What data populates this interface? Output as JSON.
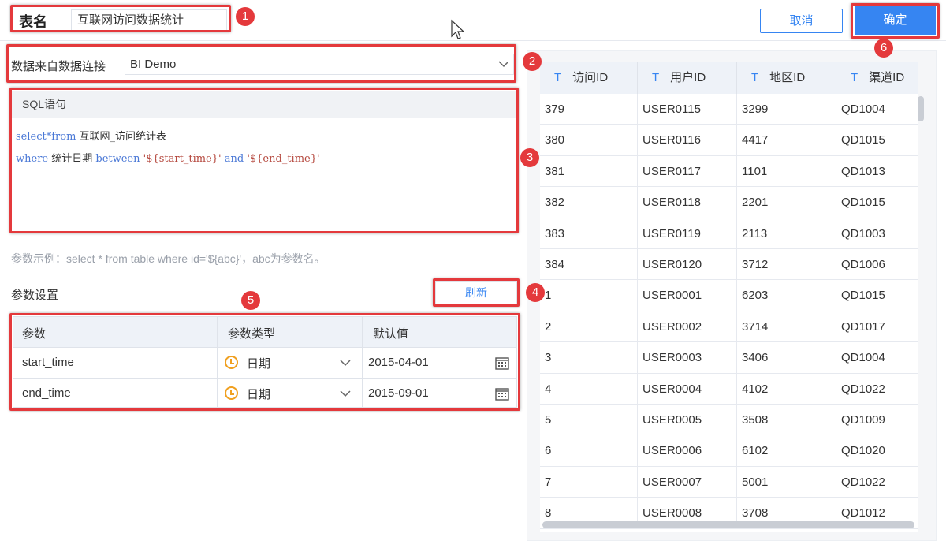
{
  "header": {
    "table_name_label": "表名",
    "table_name_value": "互联网访问数据统计",
    "cancel_label": "取消",
    "confirm_label": "确定"
  },
  "datasource": {
    "label": "数据来自数据连接",
    "selected": "BI Demo"
  },
  "sql": {
    "title": "SQL语句",
    "line1": {
      "kw": "select*from",
      "rest": " 互联网_访问统计表"
    },
    "line2": {
      "kw_where": "where",
      "mid": " 统计日期 ",
      "kw_between": "between",
      "str1": " '${start_time}' ",
      "kw_and": "and",
      "str2": " '${end_time}'"
    }
  },
  "hint": "参数示例：select * from table where id='${abc}'，abc为参数名。",
  "params": {
    "title": "参数设置",
    "refresh_label": "刷新",
    "columns": [
      "参数",
      "参数类型",
      "默认值"
    ],
    "rows": [
      {
        "name": "start_time",
        "type": "日期",
        "default": "2015-04-01"
      },
      {
        "name": "end_time",
        "type": "日期",
        "default": "2015-09-01"
      }
    ]
  },
  "result": {
    "type_icon": "T",
    "columns": [
      "访问ID",
      "用户ID",
      "地区ID",
      "渠道ID"
    ],
    "rows": [
      [
        "379",
        "USER0115",
        "3299",
        "QD1004"
      ],
      [
        "380",
        "USER0116",
        "4417",
        "QD1015"
      ],
      [
        "381",
        "USER0117",
        "1101",
        "QD1013"
      ],
      [
        "382",
        "USER0118",
        "2201",
        "QD1015"
      ],
      [
        "383",
        "USER0119",
        "2113",
        "QD1003"
      ],
      [
        "384",
        "USER0120",
        "3712",
        "QD1006"
      ],
      [
        "1",
        "USER0001",
        "6203",
        "QD1015"
      ],
      [
        "2",
        "USER0002",
        "3714",
        "QD1017"
      ],
      [
        "3",
        "USER0003",
        "3406",
        "QD1004"
      ],
      [
        "4",
        "USER0004",
        "4102",
        "QD1022"
      ],
      [
        "5",
        "USER0005",
        "3508",
        "QD1009"
      ],
      [
        "6",
        "USER0006",
        "6102",
        "QD1020"
      ],
      [
        "7",
        "USER0007",
        "5001",
        "QD1022"
      ],
      [
        "8",
        "USER0008",
        "3708",
        "QD1012"
      ]
    ]
  },
  "annotations": [
    "1",
    "2",
    "3",
    "4",
    "5",
    "6"
  ],
  "colors": {
    "accent": "#3685f2",
    "highlight": "#e4393c",
    "clock": "#f0a020"
  }
}
